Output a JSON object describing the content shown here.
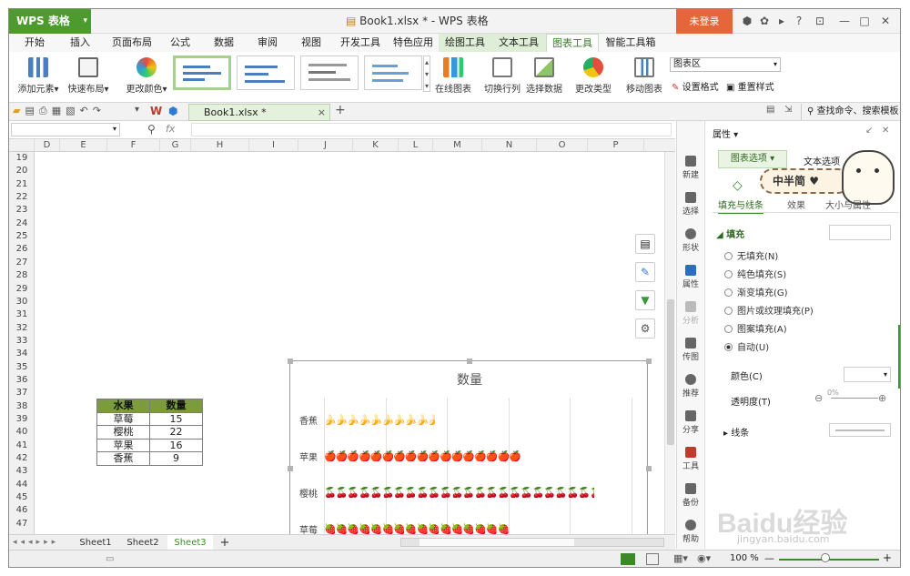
{
  "app": {
    "button": "WPS 表格",
    "doc_title": "Book1.xlsx * - WPS 表格",
    "login": "未登录"
  },
  "menu_tabs": [
    "开始",
    "插入",
    "页面布局",
    "公式",
    "数据",
    "审阅",
    "视图",
    "开发工具",
    "特色应用",
    "绘图工具",
    "文本工具",
    "图表工具",
    "智能工具箱"
  ],
  "ribbon": {
    "add_element": "添加元素",
    "quick_layout": "快速布局",
    "change_color": "更改颜色",
    "online_chart": "在线图表",
    "switch_rowcol": "切换行列",
    "select_data": "选择数据",
    "change_type": "更改类型",
    "move_chart": "移动图表",
    "chart_area_select": "图表区",
    "set_format": "设置格式",
    "reset_style": "重置样式"
  },
  "qat": {
    "doc_tab": "Book1.xlsx *",
    "search": "查找命令、搜索模板"
  },
  "formula": {
    "fx": "fx"
  },
  "columns": [
    "D",
    "E",
    "F",
    "G",
    "H",
    "I",
    "J",
    "K",
    "L",
    "M",
    "N",
    "O",
    "P"
  ],
  "rows": [
    "19",
    "20",
    "21",
    "22",
    "23",
    "24",
    "25",
    "26",
    "27",
    "28",
    "29",
    "30",
    "31",
    "32",
    "33",
    "34",
    "35",
    "36",
    "37",
    "38",
    "39",
    "40",
    "41",
    "42",
    "43",
    "44",
    "45",
    "46",
    "47"
  ],
  "table": {
    "headers": [
      "水果",
      "数量"
    ],
    "rows": [
      [
        "草莓",
        "15"
      ],
      [
        "樱桃",
        "22"
      ],
      [
        "苹果",
        "16"
      ],
      [
        "香蕉",
        "9"
      ]
    ]
  },
  "chart_data": {
    "type": "bar",
    "title": "数量",
    "categories": [
      "香蕉",
      "苹果",
      "樱桃",
      "草莓"
    ],
    "values": [
      9,
      16,
      22,
      15
    ],
    "xlim": [
      0,
      25
    ],
    "xticks": [
      "0",
      "5",
      "10",
      "15",
      "20",
      "25"
    ],
    "grid": true,
    "icons": [
      "banana",
      "apple",
      "cherry",
      "strawberry"
    ]
  },
  "sheets": [
    "Sheet1",
    "Sheet2",
    "Sheet3"
  ],
  "active_sheet": "Sheet3",
  "side_tools": [
    "新建",
    "选择",
    "形状",
    "属性",
    "分析",
    "传图",
    "推荐",
    "分享",
    "工具",
    "备份",
    "帮助"
  ],
  "panel": {
    "title": "属性",
    "tab1": "图表选项",
    "tab2": "文本选项",
    "sub1": "填充与线条",
    "sub2": "效果",
    "sub3": "大小与属性",
    "section_fill": "填充",
    "options": [
      "无填充(N)",
      "纯色填充(S)",
      "渐变填充(G)",
      "图片或纹理填充(P)",
      "图案填充(A)",
      "自动(U)"
    ],
    "selected_option": 5,
    "color_label": "颜色(C)",
    "transparency_label": "透明度(T)",
    "transparency_value": "0%",
    "section_line": "线条",
    "sticker": "中半简"
  },
  "status": {
    "zoom": "100 %"
  },
  "watermark": {
    "logo": "Baidu经验",
    "url": "jingyan.baidu.com"
  }
}
